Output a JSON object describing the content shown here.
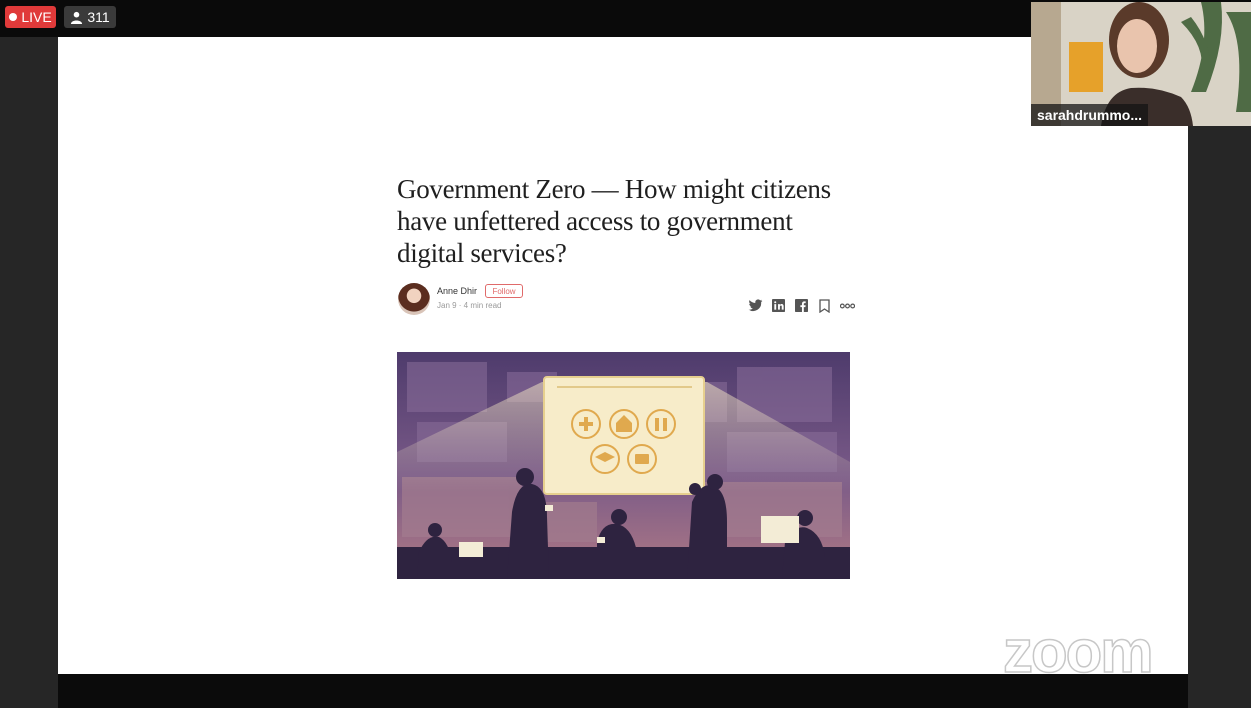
{
  "stream": {
    "live_label": "LIVE",
    "viewer_count": "311"
  },
  "article": {
    "title": "Government Zero — How might citizens have unfettered access to government digital services?",
    "author": "Anne Dhir",
    "follow_label": "Follow",
    "meta": "Jan 9 · 4 min read"
  },
  "video": {
    "participant_name": "sarahdrummo..."
  },
  "watermark": "zoom",
  "colors": {
    "live": "#e03a3a",
    "follow": "#e06a6a",
    "illustration_purple": "#5a4574"
  },
  "icons": [
    "twitter-icon",
    "linkedin-icon",
    "facebook-icon",
    "bookmark-icon",
    "more-icon"
  ]
}
